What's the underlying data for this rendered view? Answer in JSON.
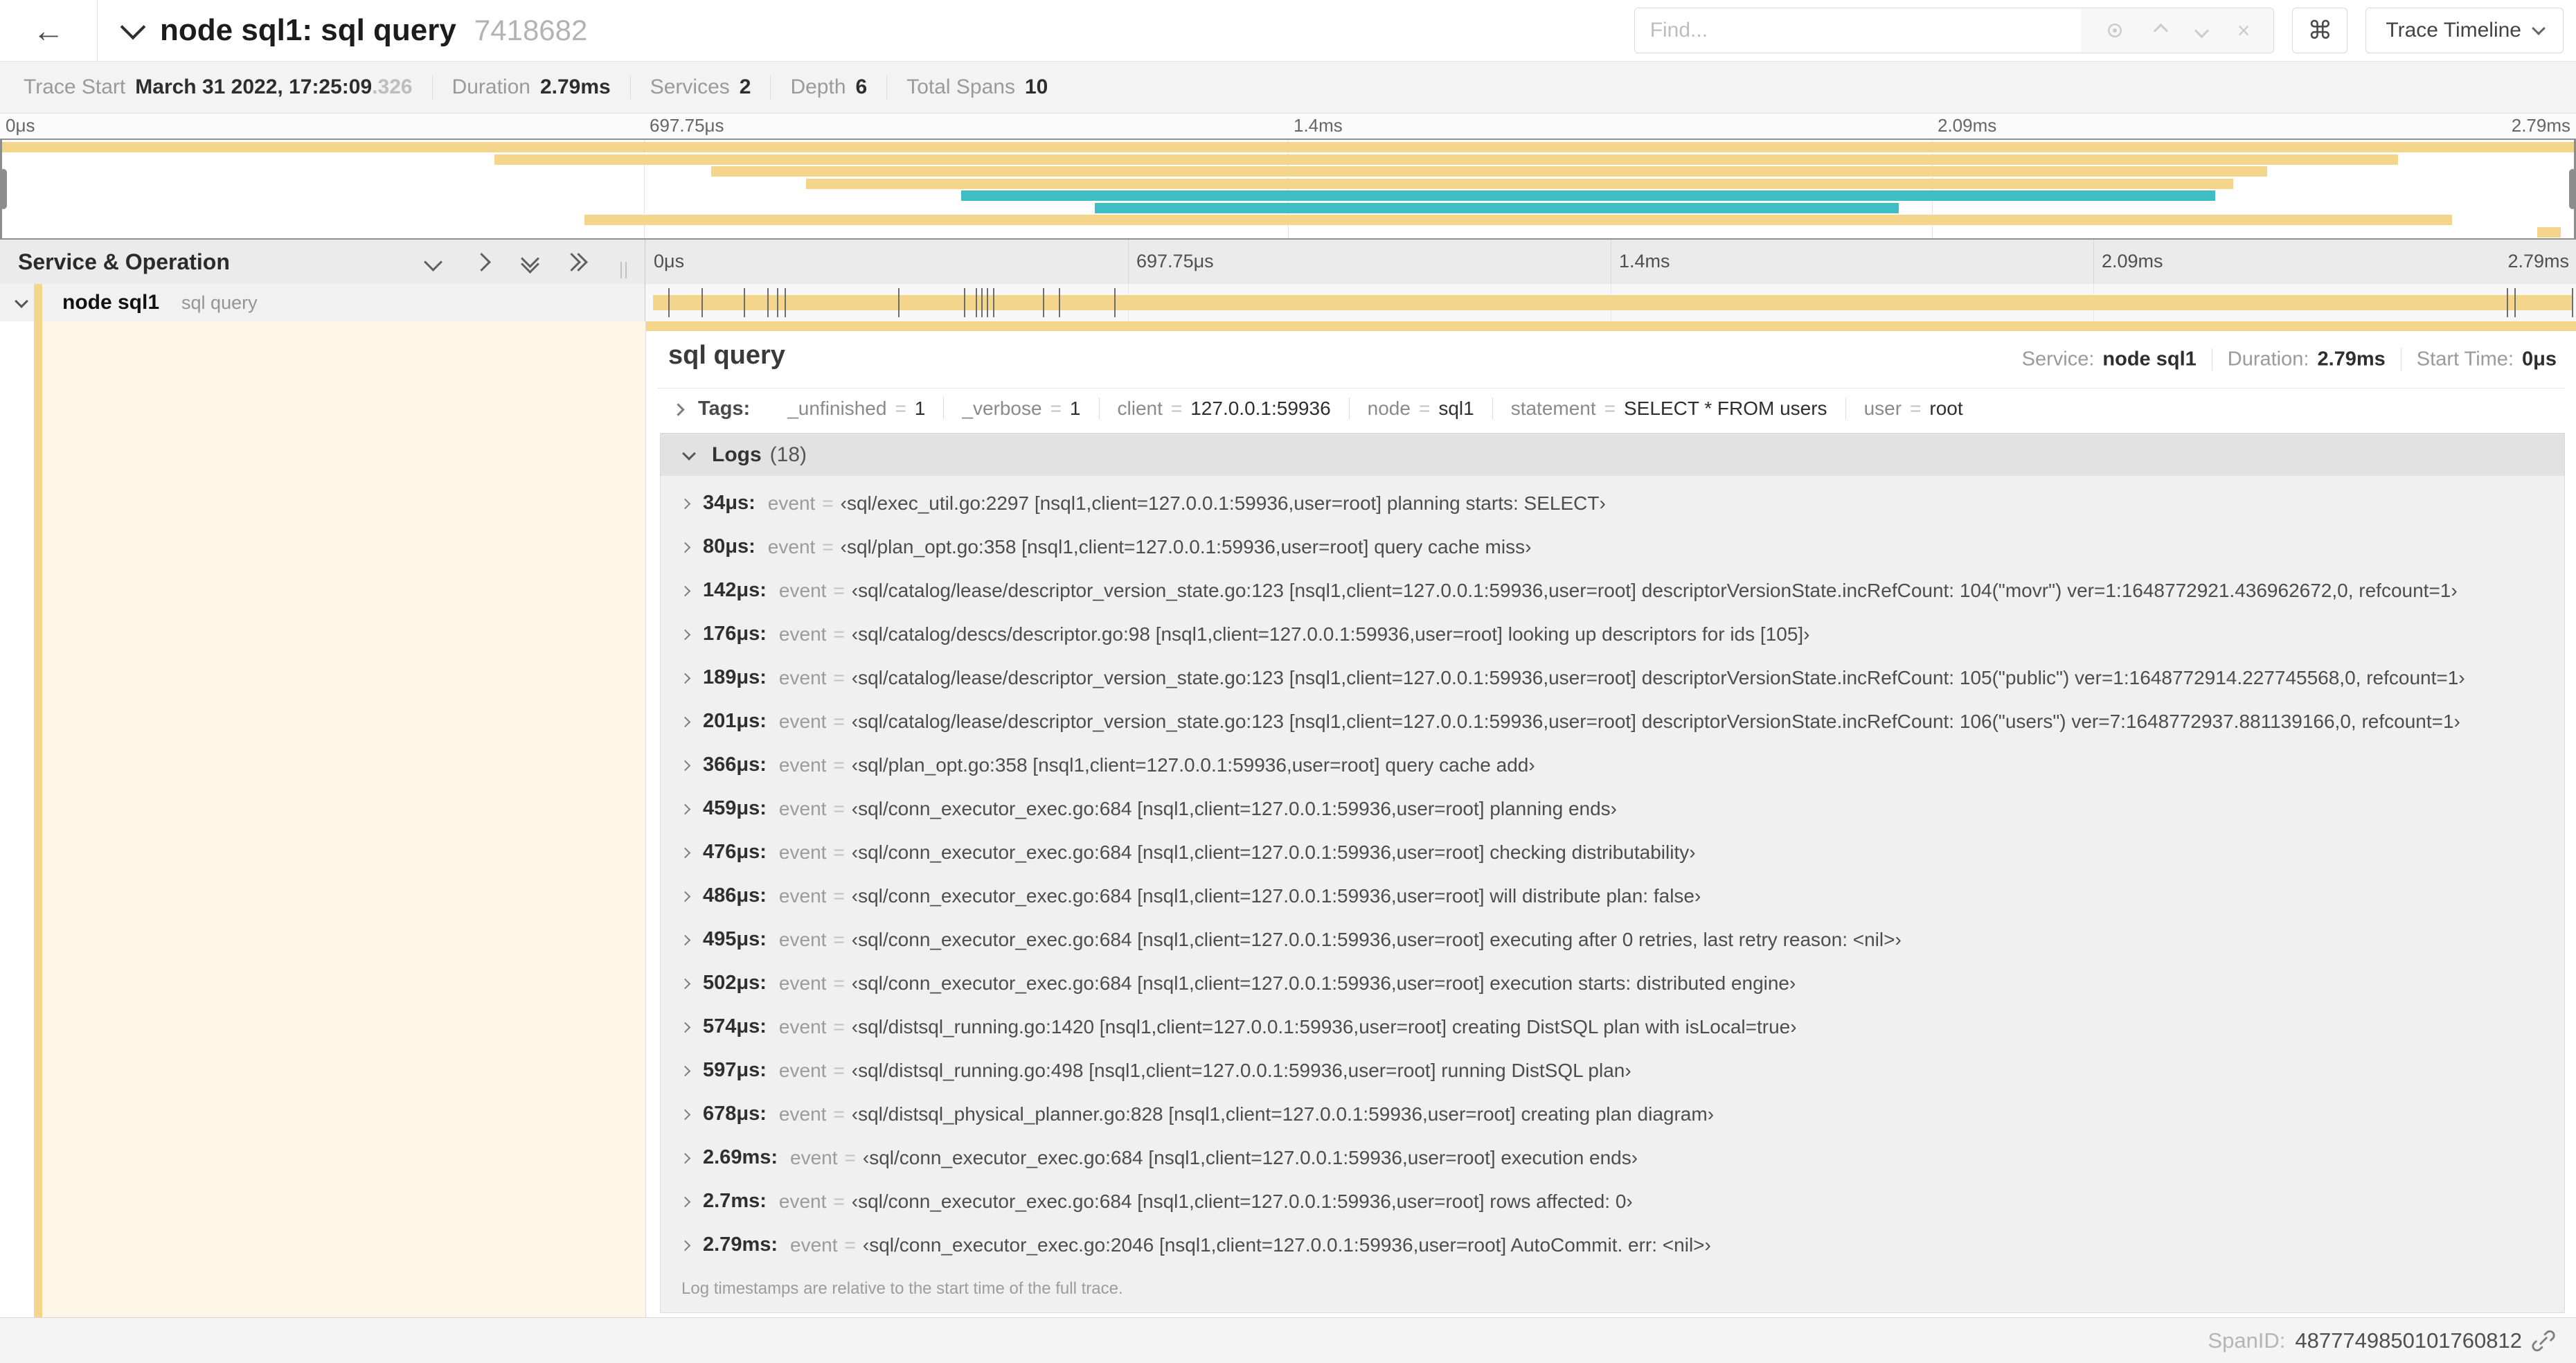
{
  "colors": {
    "span_tan": "#F3D68C",
    "span_teal": "#3FBDC5",
    "detail_cream": "#FDF6E6"
  },
  "header": {
    "back_arrow": "←",
    "title": "node sql1: sql query",
    "trace_id": "7418682",
    "find_placeholder": "Find...",
    "clear_glyph": "×",
    "shortcut_glyph": "⌘",
    "view_selector": "Trace Timeline"
  },
  "trace_meta": {
    "items": [
      {
        "label": "Trace Start",
        "value": "March 31 2022, 17:25:09",
        "suffix": ".326"
      },
      {
        "label": "Duration",
        "value": "2.79ms"
      },
      {
        "label": "Services",
        "value": "2"
      },
      {
        "label": "Depth",
        "value": "6"
      },
      {
        "label": "Total Spans",
        "value": "10"
      }
    ]
  },
  "timeline": {
    "tick_labels": [
      "0μs",
      "697.75μs",
      "1.4ms",
      "2.09ms",
      "2.79ms"
    ],
    "tick_pcts": [
      0,
      25,
      50,
      75,
      100
    ],
    "grid_pcts": [
      25,
      50,
      75
    ]
  },
  "minimap": {
    "bars": [
      {
        "row": 0,
        "start_pct": 0,
        "end_pct": 100,
        "color": "tan"
      },
      {
        "row": 1,
        "start_pct": 19.2,
        "end_pct": 93.1,
        "color": "tan"
      },
      {
        "row": 2,
        "start_pct": 27.6,
        "end_pct": 88.0,
        "color": "tan"
      },
      {
        "row": 3,
        "start_pct": 31.3,
        "end_pct": 86.7,
        "color": "tan"
      },
      {
        "row": 4,
        "start_pct": 37.3,
        "end_pct": 86.0,
        "color": "teal"
      },
      {
        "row": 5,
        "start_pct": 42.5,
        "end_pct": 73.7,
        "color": "teal"
      },
      {
        "row": 6,
        "start_pct": 22.7,
        "end_pct": 95.2,
        "color": "tan"
      },
      {
        "row": 7,
        "start_pct": 98.5,
        "end_pct": 99.4,
        "color": "tan"
      }
    ]
  },
  "grid": {
    "left_header": "Service & Operation"
  },
  "span_row": {
    "service": "node sql1",
    "operation": "sql query",
    "log_marker_pcts": [
      1.2,
      2.9,
      5.1,
      6.3,
      6.8,
      7.2,
      13.1,
      16.5,
      17.1,
      17.4,
      17.7,
      18.0,
      20.6,
      21.4,
      24.3,
      96.4,
      96.8,
      99.8
    ]
  },
  "detail": {
    "title": "sql query",
    "meta": [
      {
        "label": "Service:",
        "value": "node sql1"
      },
      {
        "label": "Duration:",
        "value": "2.79ms"
      },
      {
        "label": "Start Time:",
        "value": "0μs"
      }
    ],
    "tags_label": "Tags:",
    "tags": [
      {
        "key": "_unfinished",
        "value": "1"
      },
      {
        "key": "_verbose",
        "value": "1"
      },
      {
        "key": "client",
        "value": "127.0.0.1:59936"
      },
      {
        "key": "node",
        "value": "sql1"
      },
      {
        "key": "statement",
        "value": "SELECT * FROM users"
      },
      {
        "key": "user",
        "value": "root"
      }
    ],
    "logs_label": "Logs",
    "logs_count": "(18)",
    "logs_field": "event",
    "logs": [
      {
        "time": "34μs:",
        "value": "‹sql/exec_util.go:2297 [nsql1,client=127.0.0.1:59936,user=root] planning starts: SELECT›"
      },
      {
        "time": "80μs:",
        "value": "‹sql/plan_opt.go:358 [nsql1,client=127.0.0.1:59936,user=root] query cache miss›"
      },
      {
        "time": "142μs:",
        "value": "‹sql/catalog/lease/descriptor_version_state.go:123 [nsql1,client=127.0.0.1:59936,user=root] descriptorVersionState.incRefCount: 104(\"movr\") ver=1:1648772921.436962672,0, refcount=1›"
      },
      {
        "time": "176μs:",
        "value": "‹sql/catalog/descs/descriptor.go:98 [nsql1,client=127.0.0.1:59936,user=root] looking up descriptors for ids [105]›"
      },
      {
        "time": "189μs:",
        "value": "‹sql/catalog/lease/descriptor_version_state.go:123 [nsql1,client=127.0.0.1:59936,user=root] descriptorVersionState.incRefCount: 105(\"public\") ver=1:1648772914.227745568,0, refcount=1›"
      },
      {
        "time": "201μs:",
        "value": "‹sql/catalog/lease/descriptor_version_state.go:123 [nsql1,client=127.0.0.1:59936,user=root] descriptorVersionState.incRefCount: 106(\"users\") ver=7:1648772937.881139166,0, refcount=1›"
      },
      {
        "time": "366μs:",
        "value": "‹sql/plan_opt.go:358 [nsql1,client=127.0.0.1:59936,user=root] query cache add›"
      },
      {
        "time": "459μs:",
        "value": "‹sql/conn_executor_exec.go:684 [nsql1,client=127.0.0.1:59936,user=root] planning ends›"
      },
      {
        "time": "476μs:",
        "value": "‹sql/conn_executor_exec.go:684 [nsql1,client=127.0.0.1:59936,user=root] checking distributability›"
      },
      {
        "time": "486μs:",
        "value": "‹sql/conn_executor_exec.go:684 [nsql1,client=127.0.0.1:59936,user=root] will distribute plan: false›"
      },
      {
        "time": "495μs:",
        "value": "‹sql/conn_executor_exec.go:684 [nsql1,client=127.0.0.1:59936,user=root] executing after 0 retries, last retry reason: <nil>›"
      },
      {
        "time": "502μs:",
        "value": "‹sql/conn_executor_exec.go:684 [nsql1,client=127.0.0.1:59936,user=root] execution starts: distributed engine›"
      },
      {
        "time": "574μs:",
        "value": "‹sql/distsql_running.go:1420 [nsql1,client=127.0.0.1:59936,user=root] creating DistSQL plan with isLocal=true›"
      },
      {
        "time": "597μs:",
        "value": "‹sql/distsql_running.go:498 [nsql1,client=127.0.0.1:59936,user=root] running DistSQL plan›"
      },
      {
        "time": "678μs:",
        "value": "‹sql/distsql_physical_planner.go:828 [nsql1,client=127.0.0.1:59936,user=root] creating plan diagram›"
      },
      {
        "time": "2.69ms:",
        "value": "‹sql/conn_executor_exec.go:684 [nsql1,client=127.0.0.1:59936,user=root] execution ends›"
      },
      {
        "time": "2.7ms:",
        "value": "‹sql/conn_executor_exec.go:684 [nsql1,client=127.0.0.1:59936,user=root] rows affected: 0›"
      },
      {
        "time": "2.79ms:",
        "value": "‹sql/conn_executor_exec.go:2046 [nsql1,client=127.0.0.1:59936,user=root] AutoCommit. err: <nil>›"
      }
    ],
    "logs_note": "Log timestamps are relative to the start time of the full trace."
  },
  "footer": {
    "spanid_label": "SpanID:",
    "spanid_value": "4877749850101760812"
  }
}
